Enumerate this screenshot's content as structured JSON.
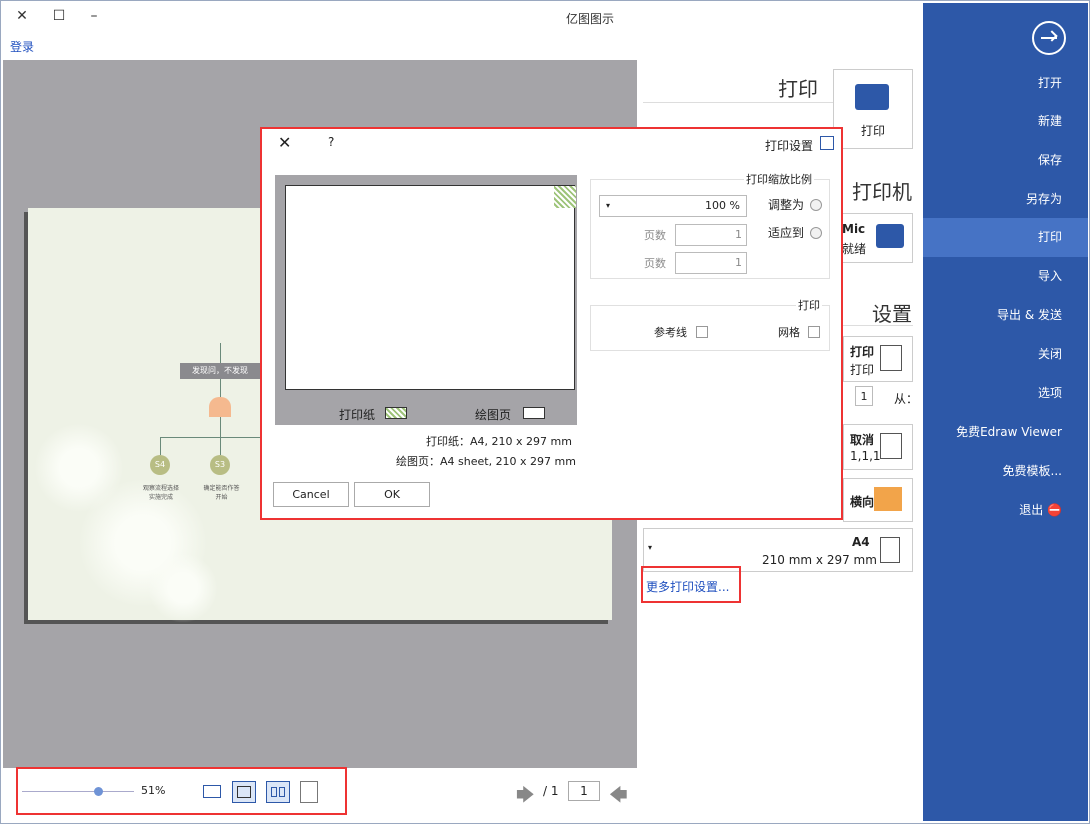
{
  "window": {
    "title": "亿图图示",
    "close_glyph": "✕",
    "max_glyph": "☐",
    "min_glyph": "–",
    "login": "登录"
  },
  "sidebar": {
    "back_icon": "arrow-right-circle-icon",
    "items": [
      "打开",
      "新建",
      "保存",
      "另存为",
      "打印",
      "导入",
      "导出 & 发送",
      "关闭",
      "选项",
      "免费Edraw Viewer",
      "免费模板...",
      "退出"
    ],
    "active_index": 4
  },
  "print_panel": {
    "heading": "打印",
    "print_button": "打印",
    "printer_heading": "打印机",
    "printer_name": "Mic",
    "printer_status": "就绪",
    "settings_heading": "设置",
    "collate_title": "打印",
    "collate_sub": "打印",
    "from_label": "从：",
    "from_value": "1",
    "sides_title": "取消",
    "sides_sub": "1,1,1",
    "orientation_title": "横向",
    "paper_title": "A4",
    "paper_size": "210 mm x 297 mm",
    "more_settings": "更多打印设置..."
  },
  "page_preview": {
    "banner": "发现问，不发现",
    "nodes": [
      "S4",
      "S3"
    ],
    "node_text": [
      "观察流程选择",
      "确定能否作答"
    ],
    "node_sub": [
      "实施完成",
      "开始"
    ]
  },
  "bottom_bar": {
    "zoom": "51%",
    "zoom_fraction": 0.3,
    "page_current": "1",
    "page_total": "/ 1"
  },
  "dialog": {
    "title": "打印设置",
    "help": "?",
    "close": "✕",
    "scale_group": "打印缩放比例",
    "adjust_label": "调整为",
    "adjust_value": "100 %",
    "fit_label": "适应到",
    "fit_w": "1",
    "fit_h": "1",
    "pages_label": "页数",
    "print_group": "打印",
    "grid_label": "网格",
    "guides_label": "参考线",
    "legend_paper": "打印纸",
    "legend_page": "绘图页",
    "paper_info": "打印纸：A4, 210 x 297 mm",
    "page_info": "绘图页：A4 sheet, 210 x 297 mm",
    "ok": "OK",
    "cancel": "Cancel"
  },
  "colors": {
    "sidebar": "#2d58a8",
    "active": "#4673c5",
    "highlight": "#e33333",
    "canvas": "#a5a4a8",
    "page": "#eef2e6"
  }
}
